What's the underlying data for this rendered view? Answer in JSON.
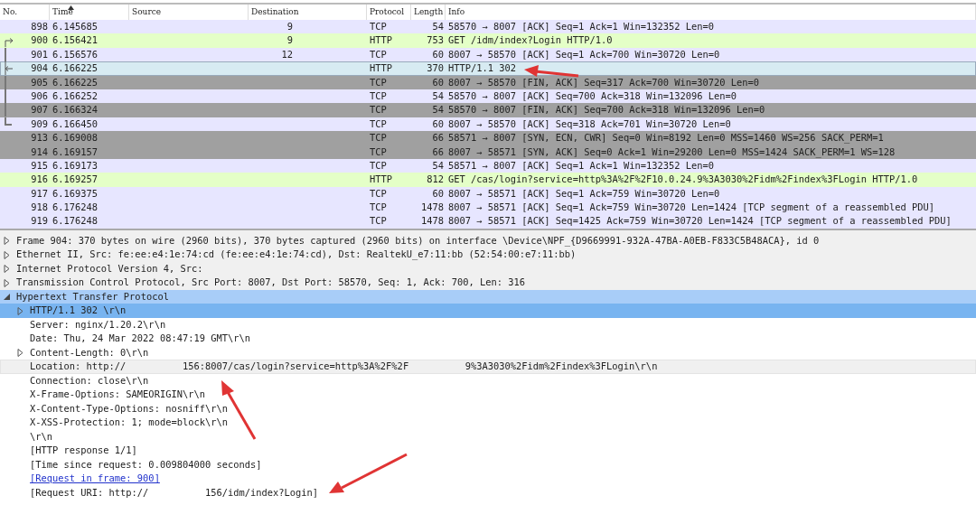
{
  "packet_list": {
    "columns": [
      "No.",
      "Time",
      "Source",
      "Destination",
      "Protocol",
      "Length",
      "Info"
    ],
    "rows": [
      {
        "no": "898",
        "time": "6.145685",
        "destination": "9",
        "protocol": "TCP",
        "length": "54",
        "info": "58570 → 8007 [ACK] Seq=1 Ack=1 Win=132352 Len=0",
        "color": "#e7e6ff",
        "selected": false,
        "kind": "plain"
      },
      {
        "no": "900",
        "time": "6.156421",
        "destination": "9",
        "protocol": "HTTP",
        "length": "753",
        "info": "GET /idm/index?Login HTTP/1.0",
        "color": "#e4ffc7",
        "selected": false,
        "kind": "request"
      },
      {
        "no": "901",
        "time": "6.156576",
        "destination": "12",
        "protocol": "TCP",
        "length": "60",
        "info": "8007 → 58570 [ACK] Seq=1 Ack=700 Win=30720 Len=0",
        "color": "#e7e6ff",
        "selected": false,
        "kind": "middle"
      },
      {
        "no": "904",
        "time": "6.166225",
        "protocol": "HTTP",
        "length": "370",
        "info": "HTTP/1.1 302",
        "selected": true,
        "kind": "response"
      },
      {
        "no": "905",
        "time": "6.166225",
        "protocol": "TCP",
        "length": "60",
        "info": "8007 → 58570 [FIN, ACK] Seq=317 Ack=700 Win=30720 Len=0",
        "color": "#a0a0a0",
        "selected": false,
        "kind": "middle"
      },
      {
        "no": "906",
        "time": "6.166252",
        "protocol": "TCP",
        "length": "54",
        "info": "58570 → 8007 [ACK] Seq=700 Ack=318 Win=132096 Len=0",
        "color": "#e7e6ff",
        "selected": false,
        "kind": "middle"
      },
      {
        "no": "907",
        "time": "6.166324",
        "protocol": "TCP",
        "length": "54",
        "info": "58570 → 8007 [FIN, ACK] Seq=700 Ack=318 Win=132096 Len=0",
        "color": "#a0a0a0",
        "selected": false,
        "kind": "middle"
      },
      {
        "no": "909",
        "time": "6.166450",
        "protocol": "TCP",
        "length": "60",
        "info": "8007 → 58570 [ACK] Seq=318 Ack=701 Win=30720 Len=0",
        "color": "#e7e6ff",
        "selected": false,
        "kind": "end"
      },
      {
        "no": "913",
        "time": "6.169008",
        "protocol": "TCP",
        "length": "66",
        "info": "58571 → 8007 [SYN, ECN, CWR] Seq=0 Win=8192 Len=0 MSS=1460 WS=256 SACK_PERM=1",
        "color": "#a0a0a0",
        "selected": false,
        "kind": "plain"
      },
      {
        "no": "914",
        "time": "6.169157",
        "protocol": "TCP",
        "length": "66",
        "info": "8007 → 58571 [SYN, ACK] Seq=0 Ack=1 Win=29200 Len=0 MSS=1424 SACK_PERM=1 WS=128",
        "color": "#a0a0a0",
        "selected": false,
        "kind": "plain"
      },
      {
        "no": "915",
        "time": "6.169173",
        "protocol": "TCP",
        "length": "54",
        "info": "58571 → 8007 [ACK] Seq=1 Ack=1 Win=132352 Len=0",
        "color": "#e7e6ff",
        "selected": false,
        "kind": "plain"
      },
      {
        "no": "916",
        "time": "6.169257",
        "protocol": "HTTP",
        "length": "812",
        "info": "GET /cas/login?service=http%3A%2F%2F10.0.24.9%3A3030%2Fidm%2Findex%3FLogin HTTP/1.0",
        "color": "#e4ffc7",
        "selected": false,
        "kind": "plain"
      },
      {
        "no": "917",
        "time": "6.169375",
        "protocol": "TCP",
        "length": "60",
        "info": "8007 → 58571 [ACK] Seq=1 Ack=759 Win=30720 Len=0",
        "color": "#e7e6ff",
        "selected": false,
        "kind": "plain"
      },
      {
        "no": "918",
        "time": "6.176248",
        "protocol": "TCP",
        "length": "1478",
        "info": "8007 → 58571 [ACK] Seq=1 Ack=759 Win=30720 Len=1424 [TCP segment of a reassembled PDU]",
        "color": "#e7e6ff",
        "selected": false,
        "kind": "plain"
      },
      {
        "no": "919",
        "time": "6.176248",
        "protocol": "TCP",
        "length": "1478",
        "info": "8007 → 58571 [ACK] Seq=1425 Ack=759 Win=30720 Len=1424 [TCP segment of a reassembled PDU]",
        "color": "#e7e6ff",
        "selected": false,
        "kind": "plain"
      }
    ]
  },
  "details": [
    {
      "text": "Frame 904: 370 bytes on wire (2960 bits), 370 bytes captured (2960 bits) on interface \\Device\\NPF_{D9669991-932A-47BA-A0EB-F833C5B48ACA}, id 0",
      "expanded": false,
      "selected": false
    },
    {
      "text": "Ethernet II, Src: fe:ee:e4:1e:74:cd (fe:ee:e4:1e:74:cd), Dst: RealtekU_e7:11:bb (52:54:00:e7:11:bb)",
      "expanded": false,
      "selected": false
    },
    {
      "text": "Internet Protocol Version 4, Src:",
      "expanded": false,
      "selected": false
    },
    {
      "text": "Transmission Control Protocol, Src Port: 8007, Dst Port: 58570, Seq: 1, Ack: 700, Len: 316",
      "expanded": false,
      "selected": false
    },
    {
      "text": "Hypertext Transfer Protocol",
      "expanded": true,
      "selected": false,
      "children": [
        {
          "text": "HTTP/1.1 302 \\r\\n",
          "expanded": false,
          "selected": true
        },
        {
          "text": "Server: nginx/1.20.2\\r\\n",
          "selected": false
        },
        {
          "text": "Date: Thu, 24 Mar 2022 08:47:19 GMT\\r\\n",
          "selected": false
        },
        {
          "text": "Content-Length: 0\\r\\n",
          "expanded": false,
          "selected": false
        },
        {
          "text": "Location: http://          156:8007/cas/login?service=http%3A%2F%2F          9%3A3030%2Fidm%2Findex%3FLogin\\r\\n",
          "selected": false,
          "hovered": true
        },
        {
          "text": "Connection: close\\r\\n",
          "selected": false
        },
        {
          "text": "X-Frame-Options: SAMEORIGIN\\r\\n",
          "selected": false
        },
        {
          "text": "X-Content-Type-Options: nosniff\\r\\n",
          "selected": false
        },
        {
          "text": "X-XSS-Protection: 1; mode=block\\r\\n",
          "selected": false
        },
        {
          "text": "\\r\\n",
          "selected": false
        },
        {
          "text": "[HTTP response 1/1]",
          "selected": false
        },
        {
          "text": "[Time since request: 0.009804000 seconds]",
          "selected": false
        },
        {
          "text": "[Request in frame: 900]",
          "selected": false,
          "kind": "link"
        },
        {
          "text": "[Request URI: http://          156/idm/index?Login]",
          "selected": false
        }
      ]
    }
  ]
}
